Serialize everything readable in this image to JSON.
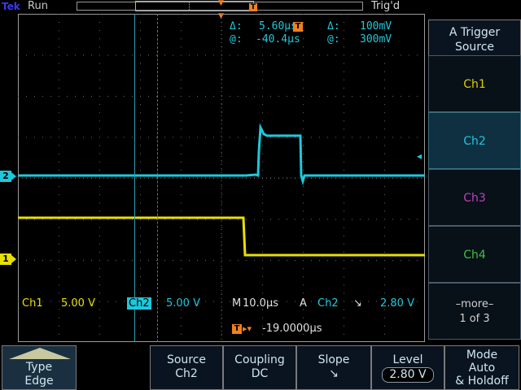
{
  "status_bar": {
    "brand": "Tek",
    "run_state": "Run",
    "trigger_state": "Trig'd",
    "trigger_marker": "T"
  },
  "cursor_readout": {
    "delta_time_label": "Δ:",
    "delta_time": "5.60µs",
    "at_time_label": "@:",
    "at_time": "-40.4µs",
    "delta_volt_label": "Δ:",
    "delta_volt": "100mV",
    "at_volt_label": "@:",
    "at_volt": "300mV",
    "time_marker": "T"
  },
  "channel_markers": {
    "ch2": "2",
    "ch1": "1",
    "trigger_level_arrow": "◂"
  },
  "channel_settings": {
    "ch1_label": "Ch1",
    "ch1_scale": "5.00 V",
    "ch2_label": "Ch2",
    "ch2_scale": "5.00 V"
  },
  "horizontal": {
    "mode": "M",
    "timebase": "10.0µs",
    "trig_type": "A",
    "trig_source": "Ch2",
    "trig_slope_symbol": "↘",
    "trig_level": "2.80 V",
    "position_marker": "T",
    "position_arrow": "▸▾",
    "position": "-19.0000µs"
  },
  "right_menu": {
    "title_line1": "A Trigger",
    "title_line2": "Source",
    "options": [
      "Ch1",
      "Ch2",
      "Ch3",
      "Ch4"
    ],
    "option_colors": [
      "#d8d000",
      "#1ec8dc",
      "#c040c0",
      "#40c040"
    ],
    "selected": "Ch2",
    "more_line1": "–more–",
    "more_line2": "1 of 3"
  },
  "bottom_menu": {
    "type_label": "Type",
    "type_value": "Edge",
    "source_label": "Source",
    "source_value": "Ch2",
    "coupling_label": "Coupling",
    "coupling_value": "DC",
    "slope_label": "Slope",
    "slope_value": "↘",
    "level_label": "Level",
    "level_value": "2.80 V",
    "mode_line1": "Mode",
    "mode_line2": "Auto",
    "mode_line3": "& Holdoff"
  },
  "colors": {
    "ch1": "#e8e000",
    "ch2": "#1ec8dc",
    "trigger": "#f08020",
    "graticule": "#9a9a9a"
  }
}
